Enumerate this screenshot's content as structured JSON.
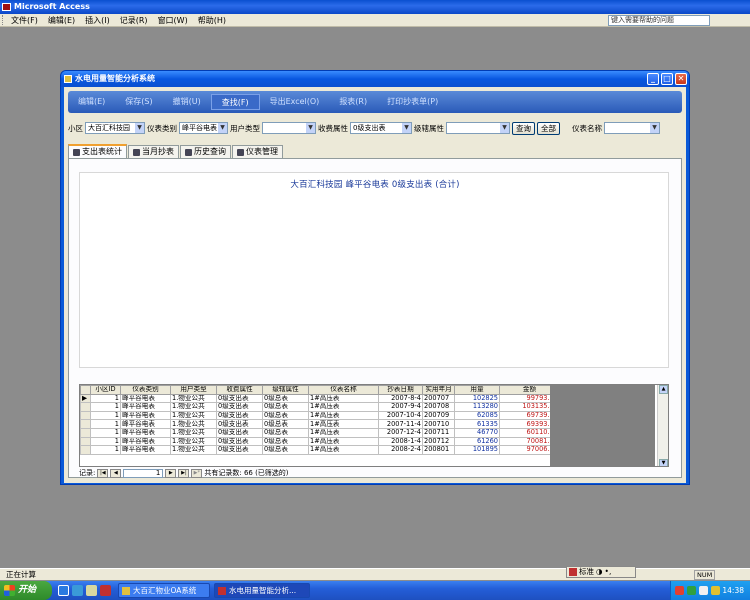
{
  "app": {
    "title": "Microsoft Access",
    "menu": [
      "文件(F)",
      "编辑(E)",
      "插入(I)",
      "记录(R)",
      "窗口(W)",
      "帮助(H)"
    ],
    "help_placeholder": "键入需要帮助的问题"
  },
  "window": {
    "title": "水电用量智能分析系统",
    "controls": {
      "minimize": "_",
      "maximize": "□",
      "close": "✕"
    }
  },
  "toolbar": [
    "编辑(E)",
    "保存(S)",
    "撤销(U)",
    "查找(F)",
    "导出Excel(O)",
    "报表(R)",
    "打印抄表单(P)"
  ],
  "toolbar_active": "查找(F)",
  "filters": {
    "community_label": "小区",
    "community_value": "大百汇科技园",
    "meter_type_label": "仪表类别",
    "meter_type_value": "峰平谷电表",
    "user_type_label": "用户类型",
    "user_type_value": "",
    "fee_attr_label": "收费属性",
    "fee_attr_value": "0级支出表",
    "level_attr_label": "级辖属性",
    "level_attr_value": "",
    "query_button": "查询",
    "all_button": "全部",
    "meter_name_label": "仪表名称",
    "meter_name_value": ""
  },
  "tabs": [
    "支出表统计",
    "当月抄表",
    "历史查询",
    "仪表管理"
  ],
  "active_tab": "支出表统计",
  "report": {
    "title": "大百汇科技园 峰平谷电表 0级支出表 (合计)"
  },
  "grid": {
    "columns": [
      "小区ID",
      "仪表类别",
      "用户类型",
      "收费属性",
      "级辖属性",
      "仪表名称",
      "抄表日期",
      "实用年月",
      "用量",
      "金额"
    ],
    "rows": [
      [
        "1",
        "峰平谷电表",
        "1.物业公共",
        "0级支出表",
        "0级总表",
        "1#高压表",
        "2007-8-4",
        "200707",
        "102825",
        "99793.17"
      ],
      [
        "1",
        "峰平谷电表",
        "1.物业公共",
        "0级支出表",
        "0级总表",
        "1#高压表",
        "2007-9-4",
        "200708",
        "113280",
        "103135.40"
      ],
      [
        "1",
        "峰平谷电表",
        "1.物业公共",
        "0级支出表",
        "0级总表",
        "1#高压表",
        "2007-10-4",
        "200709",
        "62085",
        "69739.99"
      ],
      [
        "1",
        "峰平谷电表",
        "1.物业公共",
        "0级支出表",
        "0级总表",
        "1#高压表",
        "2007-11-4",
        "200710",
        "61335",
        "69393.28"
      ],
      [
        "1",
        "峰平谷电表",
        "1.物业公共",
        "0级支出表",
        "0级总表",
        "1#高压表",
        "2007-12-4",
        "200711",
        "46770",
        "60110.73"
      ],
      [
        "1",
        "峰平谷电表",
        "1.物业公共",
        "0级支出表",
        "0级总表",
        "1#高压表",
        "2008-1-4",
        "200712",
        "61260",
        "70081.41"
      ],
      [
        "1",
        "峰平谷电表",
        "1.物业公共",
        "0级支出表",
        "0级总表",
        "1#高压表",
        "2008-2-4",
        "200801",
        "101895",
        "97006.18"
      ]
    ]
  },
  "navigator": {
    "label": "记录:",
    "current": "1",
    "summary": "共有记录数: 66 (已筛选的)"
  },
  "status": {
    "text": "正在计算",
    "mode": "NUM",
    "ime": "标准"
  },
  "taskbar": {
    "start": "开始",
    "tasks": [
      "大百汇物业OA系统",
      "水电用量智能分析..."
    ],
    "clock": "14:38"
  }
}
